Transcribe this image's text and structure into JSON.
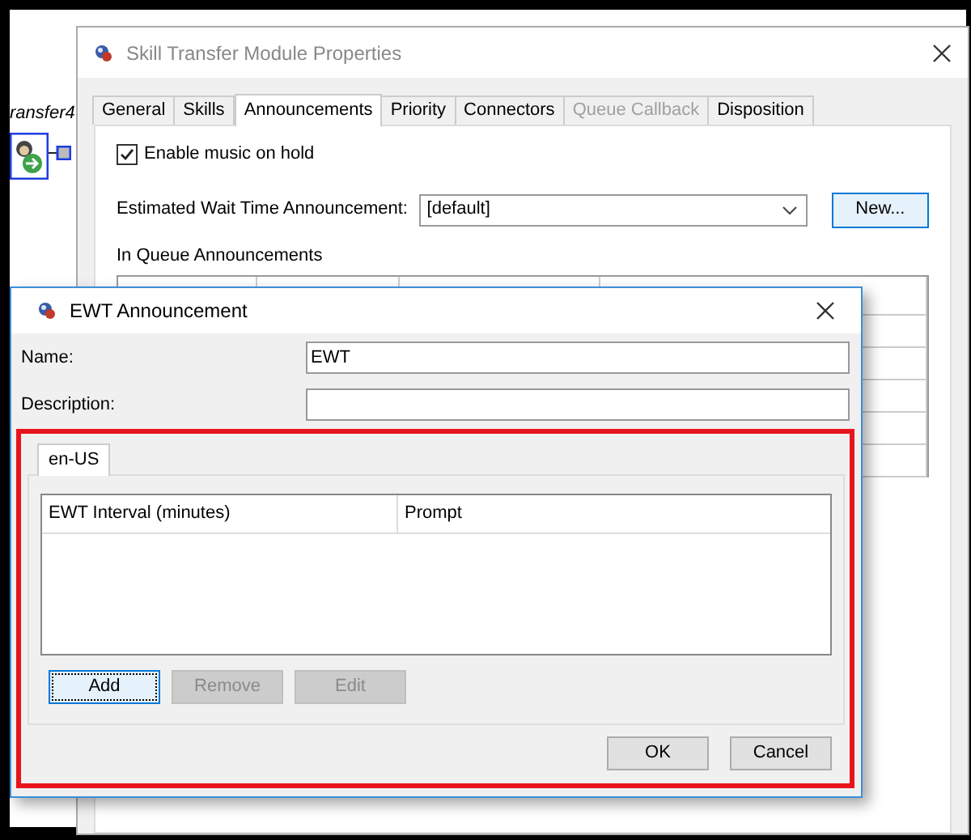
{
  "canvas": {
    "node_label": "ransfer4"
  },
  "properties_window": {
    "title": "Skill Transfer Module Properties",
    "tabs": [
      {
        "label": "General",
        "selected": false,
        "disabled": false
      },
      {
        "label": "Skills",
        "selected": false,
        "disabled": false
      },
      {
        "label": "Announcements",
        "selected": true,
        "disabled": false
      },
      {
        "label": "Priority",
        "selected": false,
        "disabled": false
      },
      {
        "label": "Connectors",
        "selected": false,
        "disabled": false
      },
      {
        "label": "Queue Callback",
        "selected": false,
        "disabled": true
      },
      {
        "label": "Disposition",
        "selected": false,
        "disabled": false
      }
    ],
    "music_on_hold": {
      "label": "Enable music on hold",
      "checked": true
    },
    "ewt": {
      "label": "Estimated Wait Time Announcement:",
      "value": "[default]",
      "button": "New..."
    },
    "in_queue_label": "In Queue Announcements"
  },
  "ewt_dialog": {
    "title": "EWT Announcement",
    "name": {
      "label": "Name:",
      "value": "EWT"
    },
    "description": {
      "label": "Description:"
    },
    "tabs": [
      {
        "label": "en-US",
        "selected": true
      }
    ],
    "table": {
      "columns": [
        "EWT Interval (minutes)",
        "Prompt"
      ]
    },
    "buttons": [
      {
        "label": "Add",
        "disabled": false,
        "focused": true
      },
      {
        "label": "Remove",
        "disabled": true,
        "focused": false
      },
      {
        "label": "Edit",
        "disabled": true,
        "focused": false
      }
    ],
    "footer_buttons": [
      "OK",
      "Cancel"
    ]
  }
}
